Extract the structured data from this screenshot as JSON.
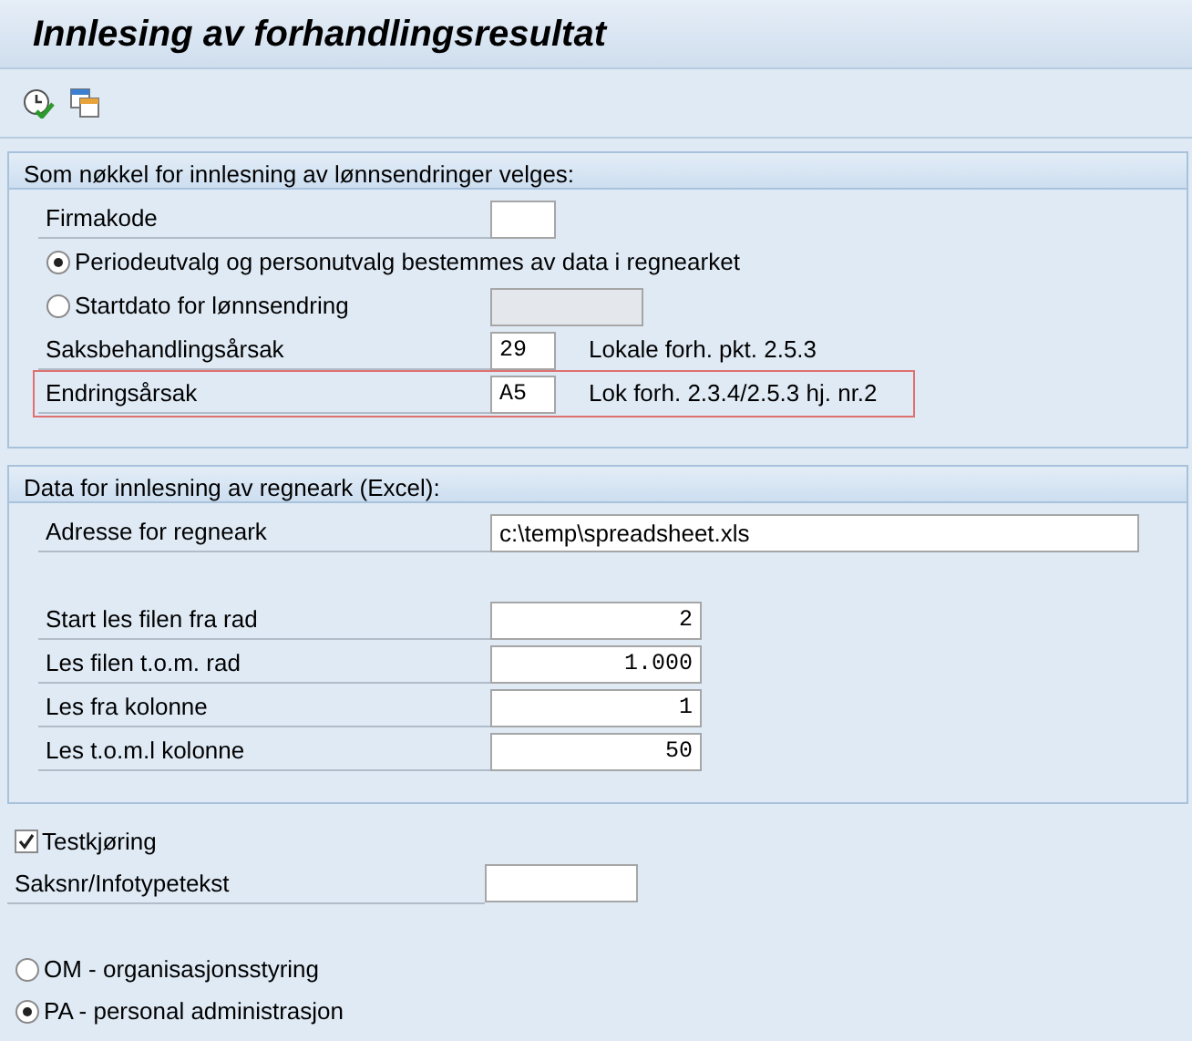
{
  "window": {
    "title": "Innlesing av forhandlingsresultat"
  },
  "toolbar": [
    {
      "kind": "execute"
    },
    {
      "kind": "copy"
    }
  ],
  "sections": [
    {
      "title": "Som nøkkel for innlesning av lønnsendringer velges:",
      "rows": [
        {
          "kind": "code",
          "label": "Firmakode",
          "highlighted": false
        },
        {
          "kind": "radio",
          "label": "Periodeutvalg og personutvalg bestemmes av data i regnearket",
          "selected": true,
          "highlighted": false
        },
        {
          "kind": "radio",
          "label": "Startdato for lønnsendring",
          "selected": false,
          "input": {
            "disabled": true
          },
          "highlighted": false
        },
        {
          "kind": "code",
          "label": "Saksbehandlingsårsak",
          "value": "29",
          "description": "Lokale forh. pkt. 2.5.3",
          "highlighted": false
        },
        {
          "kind": "code",
          "label": "Endringsårsak",
          "value": "A5",
          "description": "Lok forh. 2.3.4/2.5.3 hj. nr.2",
          "highlighted": true
        }
      ]
    },
    {
      "title": "Data for innlesning av regneark (Excel):",
      "rows": [
        {
          "kind": "path",
          "label": "Adresse for regneark",
          "value": "c:\\temp\\spreadsheet.xls"
        },
        {
          "kind": "number",
          "label": "Start les filen fra rad",
          "value": "2",
          "gap_before": true
        },
        {
          "kind": "number",
          "label": "Les filen t.o.m. rad",
          "value": "1.000"
        },
        {
          "kind": "number",
          "label": "Les fra kolonne",
          "value": "1"
        },
        {
          "kind": "number",
          "label": "Les t.o.m.l kolonne",
          "value": "50"
        }
      ]
    }
  ],
  "options": [
    {
      "kind": "checkbox",
      "label": "Testkjøring",
      "checked": true
    },
    {
      "kind": "text",
      "label": "Saksnr/Infotypetekst"
    },
    {
      "kind": "radio",
      "label": "OM - organisasjonsstyring",
      "selected": false,
      "gap_before": true
    },
    {
      "kind": "radio",
      "label": "PA - personal administrasjon",
      "selected": true
    }
  ]
}
